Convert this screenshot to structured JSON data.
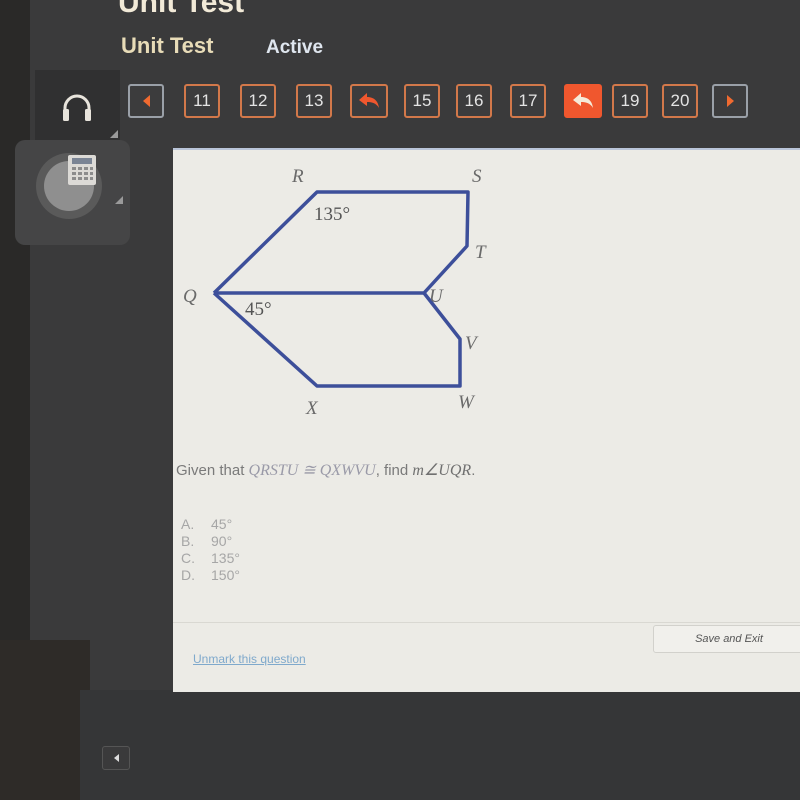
{
  "header": {
    "app_title": "Unit Test",
    "subtitle": "Unit Test",
    "status": "Active"
  },
  "nav": {
    "prev_icon": "triangle-left-icon",
    "next_icon": "triangle-right-icon",
    "items": [
      {
        "label": "11",
        "type": "number"
      },
      {
        "label": "12",
        "type": "number"
      },
      {
        "label": "13",
        "type": "number"
      },
      {
        "label": "",
        "type": "flagged",
        "icon": "return-arrow-icon"
      },
      {
        "label": "15",
        "type": "number"
      },
      {
        "label": "16",
        "type": "number"
      },
      {
        "label": "17",
        "type": "number"
      },
      {
        "label": "",
        "type": "current",
        "icon": "return-arrow-icon"
      },
      {
        "label": "19",
        "type": "number"
      },
      {
        "label": "20",
        "type": "number"
      }
    ],
    "accent_color": "#f0572e"
  },
  "tools": {
    "audio_icon": "headphones-icon",
    "calculator_icon": "calculator-icon"
  },
  "diagram": {
    "vertices": {
      "R": "R",
      "S": "S",
      "T": "T",
      "U": "U",
      "V": "V",
      "W": "W",
      "X": "X",
      "Q": "Q"
    },
    "angle_R": "135°",
    "angle_Q": "45°",
    "line_color": "#3d4f9a"
  },
  "question": {
    "prefix": "Given that ",
    "figure1": "QRSTU",
    "congruent": " ≅ ",
    "figure2": "QXWVU",
    "middle": ", find ",
    "target": "m∠UQR",
    "suffix": "."
  },
  "choices": [
    {
      "letter": "A.",
      "value": "45°"
    },
    {
      "letter": "B.",
      "value": "90°"
    },
    {
      "letter": "C.",
      "value": "135°"
    },
    {
      "letter": "D.",
      "value": "150°"
    }
  ],
  "footer": {
    "save_exit": "Save and Exit",
    "unmark": "Unmark this question"
  }
}
